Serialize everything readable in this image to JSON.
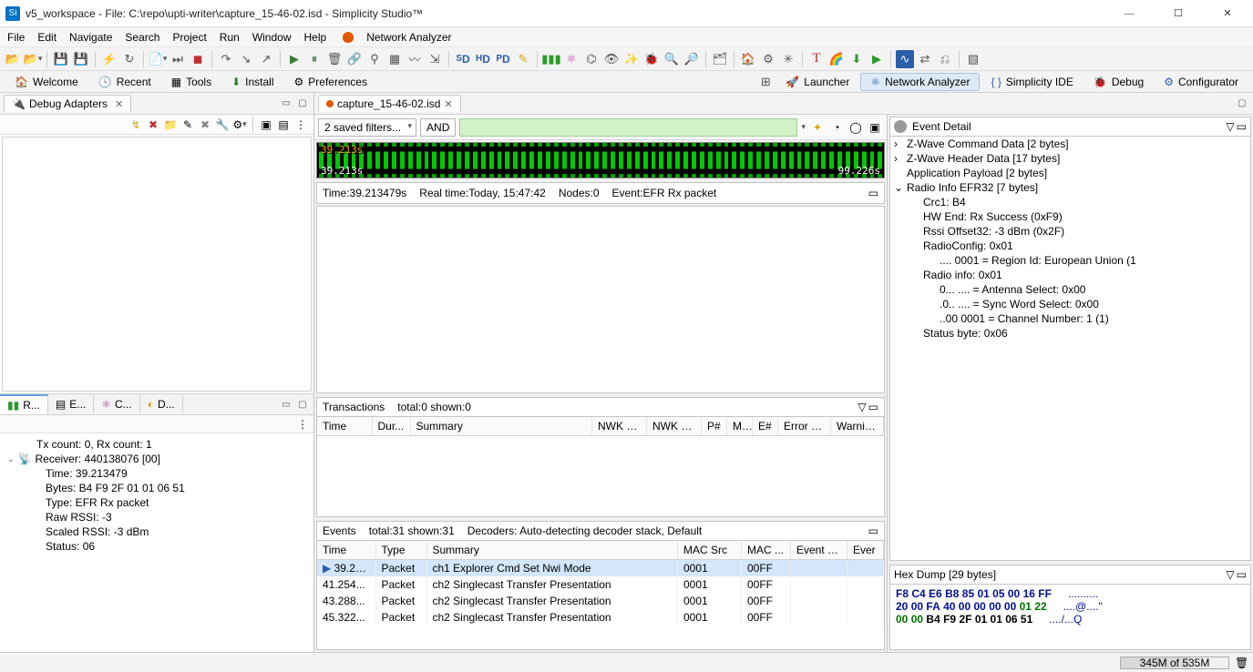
{
  "window": {
    "title": "v5_workspace - File: C:\\repo\\upti-writer\\capture_15-46-02.isd - Simplicity Studio™",
    "app_icon_letter": "Si"
  },
  "menubar": [
    "File",
    "Edit",
    "Navigate",
    "Search",
    "Project",
    "Run",
    "Window",
    "Help",
    "Network Analyzer"
  ],
  "perspectives": {
    "left": [
      {
        "icon": "home",
        "label": "Welcome"
      },
      {
        "icon": "clock",
        "label": "Recent"
      },
      {
        "icon": "grid",
        "label": "Tools"
      },
      {
        "icon": "download",
        "label": "Install"
      },
      {
        "icon": "gear",
        "label": "Preferences"
      }
    ],
    "right": [
      {
        "icon": "open",
        "label": ""
      },
      {
        "icon": "rocket",
        "label": "Launcher"
      },
      {
        "icon": "molecule",
        "label": "Network Analyzer",
        "active": true
      },
      {
        "icon": "braces",
        "label": "Simplicity IDE"
      },
      {
        "icon": "bug",
        "label": "Debug"
      },
      {
        "icon": "cfg",
        "label": "Configurator"
      }
    ]
  },
  "left_panel": {
    "tab_title": "Debug Adapters",
    "bottom_tabs": [
      "R...",
      "E...",
      "C...",
      "D..."
    ],
    "bottom_active_index": 0,
    "tx_rx_line": "Tx count: 0, Rx count: 1",
    "receiver_line": "Receiver: 440138076 [00]",
    "details": [
      "Time: 39.213479",
      "Bytes: B4 F9 2F 01 01 06 51",
      "Type: EFR Rx packet",
      "Raw RSSI: -3",
      "Scaled RSSI: -3 dBm",
      "Status: 06"
    ]
  },
  "editor_tab": "capture_15-46-02.isd",
  "filter": {
    "saved_label": "2 saved filters...",
    "and_label": "AND"
  },
  "waveform": {
    "top_label": "39.213s",
    "left_label": "39.213s",
    "right_label": "99.226s"
  },
  "infoline": {
    "time": "Time:39.213479s",
    "realtime": "Real time:Today, 15:47:42",
    "nodes": "Nodes:0",
    "event": "Event:EFR Rx packet"
  },
  "transactions": {
    "title": "Transactions",
    "stats": "total:0 shown:0",
    "columns": [
      "Time",
      "Dur...",
      "Summary",
      "NWK Src",
      "NWK D...",
      "P#",
      "M#",
      "E#",
      "Error St...",
      "Warnin..."
    ]
  },
  "events": {
    "title": "Events",
    "stats": "total:31 shown:31",
    "decoders": "Decoders: Auto-detecting decoder stack, Default",
    "columns": [
      "Time",
      "Type",
      "Summary",
      "MAC Src",
      "MAC ...",
      "Event er...",
      "Ever"
    ],
    "rows": [
      {
        "time": "39.213...",
        "type": "Packet",
        "summary": "ch1 Explorer Cmd Set Nwi Mode",
        "src": "0001",
        "dst": "00FF",
        "sel": true,
        "marker": true
      },
      {
        "time": "41.254...",
        "type": "Packet",
        "summary": "ch2 Singlecast Transfer Presentation",
        "src": "0001",
        "dst": "00FF"
      },
      {
        "time": "43.288...",
        "type": "Packet",
        "summary": "ch2 Singlecast Transfer Presentation",
        "src": "0001",
        "dst": "00FF"
      },
      {
        "time": "45.322...",
        "type": "Packet",
        "summary": "ch2 Singlecast Transfer Presentation",
        "src": "0001",
        "dst": "00FF"
      }
    ]
  },
  "event_detail": {
    "title": "Event Detail",
    "lines": [
      {
        "t": "Z-Wave Command Data [2 bytes]",
        "c": ">"
      },
      {
        "t": "Z-Wave Header Data [17 bytes]",
        "c": ">"
      },
      {
        "t": "Application Payload [2 bytes]",
        "c": " "
      },
      {
        "t": "Radio Info EFR32 [7 bytes]",
        "c": "v"
      },
      {
        "t": "Crc1: B4",
        "c": " ",
        "i": 1
      },
      {
        "t": "HW End: Rx Success (0xF9)",
        "c": " ",
        "i": 1
      },
      {
        "t": "Rssi Offset32: -3 dBm (0x2F)",
        "c": " ",
        "i": 1
      },
      {
        "t": "RadioConfig: 0x01",
        "c": " ",
        "i": 1
      },
      {
        "t": ".... 0001 = Region Id: European Union (1",
        "c": " ",
        "i": 2
      },
      {
        "t": "Radio info: 0x01",
        "c": " ",
        "i": 1
      },
      {
        "t": "0... .... = Antenna Select: 0x00",
        "c": " ",
        "i": 2
      },
      {
        "t": ".0.. .... = Sync Word Select: 0x00",
        "c": " ",
        "i": 2
      },
      {
        "t": "..00 0001 = Channel Number: 1 (1)",
        "c": " ",
        "i": 2
      },
      {
        "t": "Status byte: 0x06",
        "c": " ",
        "i": 1
      }
    ]
  },
  "hex": {
    "title": "Hex Dump [29 bytes]",
    "lines": [
      {
        "hex": [
          [
            "F8",
            "n"
          ],
          [
            "C4",
            "n"
          ],
          [
            "E6",
            "n"
          ],
          [
            "B8",
            "n"
          ],
          [
            "85",
            "n"
          ],
          [
            "01",
            "n"
          ],
          [
            "05",
            "n"
          ],
          [
            "00",
            "n"
          ],
          [
            "16",
            "n"
          ],
          [
            "FF",
            "n"
          ]
        ],
        "ascii": ".........."
      },
      {
        "hex": [
          [
            "20",
            "n"
          ],
          [
            "00",
            "n"
          ],
          [
            "FA",
            "n"
          ],
          [
            "40",
            "n"
          ],
          [
            "00",
            "n"
          ],
          [
            "00",
            "n"
          ],
          [
            "00",
            "n"
          ],
          [
            "00",
            "n"
          ],
          [
            "01",
            "g"
          ],
          [
            "22",
            "g"
          ]
        ],
        "ascii": "....@....\""
      },
      {
        "hex": [
          [
            "00",
            "g"
          ],
          [
            "00",
            "g"
          ],
          [
            "B4",
            "b"
          ],
          [
            "F9",
            "b"
          ],
          [
            "2F",
            "b"
          ],
          [
            "01",
            "b"
          ],
          [
            "01",
            "b"
          ],
          [
            "06",
            "b"
          ],
          [
            "51",
            "b"
          ]
        ],
        "ascii": "..../...Q"
      }
    ]
  },
  "status": {
    "memory": "345M of 535M"
  }
}
